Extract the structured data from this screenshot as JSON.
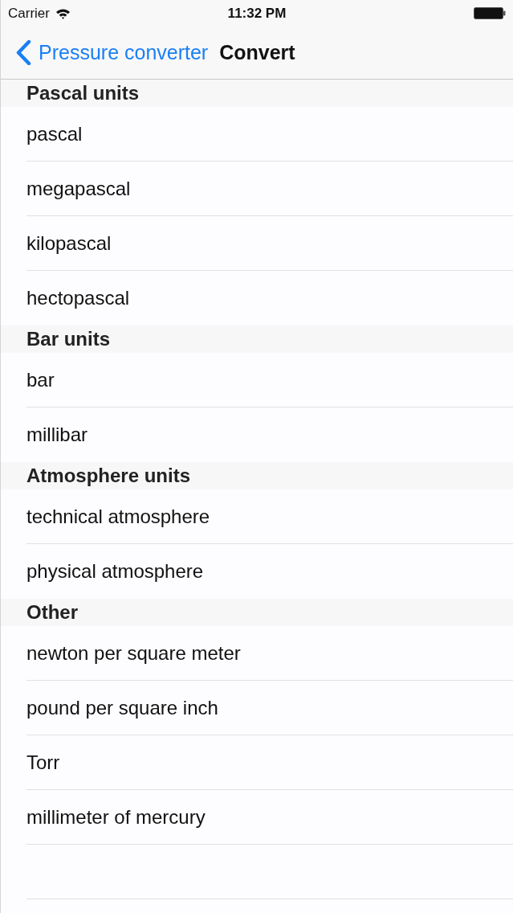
{
  "status_bar": {
    "carrier": "Carrier",
    "time": "11:32 PM"
  },
  "nav_bar": {
    "back_label": "Pressure converter",
    "title": "Convert"
  },
  "sections": [
    {
      "header": "Pascal units",
      "rows": [
        "pascal",
        "megapascal",
        "kilopascal",
        "hectopascal"
      ]
    },
    {
      "header": "Bar units",
      "rows": [
        "bar",
        "millibar"
      ]
    },
    {
      "header": "Atmosphere units",
      "rows": [
        "technical atmosphere",
        "physical atmosphere"
      ]
    },
    {
      "header": "Other",
      "rows": [
        "newton per square meter",
        "pound per square inch",
        "Torr",
        "millimeter of mercury"
      ]
    }
  ]
}
